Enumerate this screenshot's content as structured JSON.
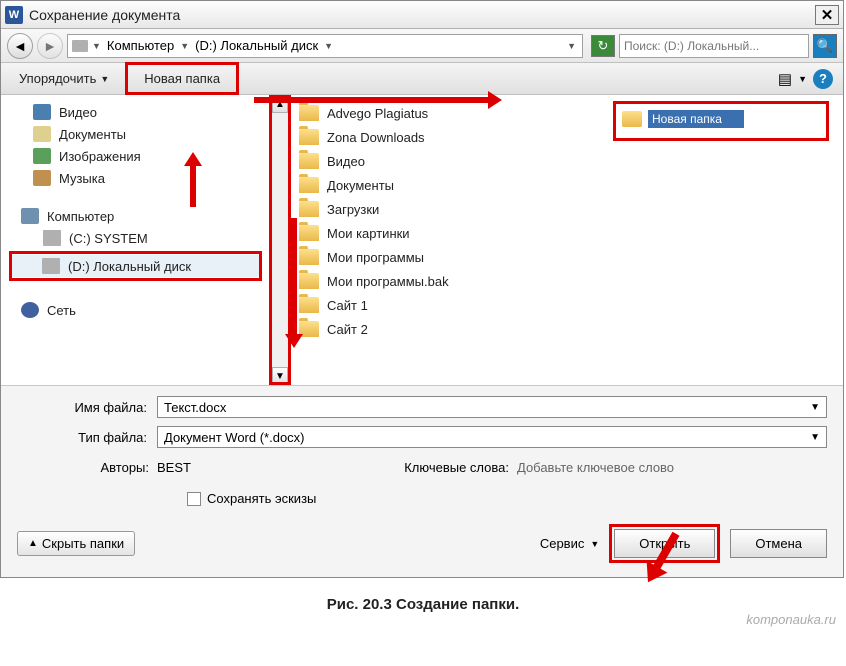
{
  "title": "Сохранение документа",
  "path": {
    "seg1": "Компьютер",
    "seg2": "(D:) Локальный диск"
  },
  "search_placeholder": "Поиск: (D:) Локальный...",
  "toolbar": {
    "organize": "Упорядочить",
    "new_folder": "Новая папка"
  },
  "sidebar": {
    "libs": [
      "Видео",
      "Документы",
      "Изображения",
      "Музыка"
    ],
    "computer": "Компьютер",
    "drives": [
      "(C:) SYSTEM",
      "(D:) Локальный диск"
    ],
    "network": "Сеть"
  },
  "folders": [
    "Advego Plagiatus",
    "Zona Downloads",
    "Видео",
    "Документы",
    "Загрузки",
    "Мои картинки",
    "Мои программы",
    "Мои программы.bak",
    "Сайт 1",
    "Сайт 2"
  ],
  "new_folder_edit": "Новая папка",
  "filename_label": "Имя файла:",
  "filename_value": "Текст.docx",
  "filetype_label": "Тип файла:",
  "filetype_value": "Документ Word (*.docx)",
  "authors_label": "Авторы:",
  "authors_value": "BEST",
  "keywords_label": "Ключевые слова:",
  "keywords_value": "Добавьте ключевое слово",
  "save_thumb": "Сохранять эскизы",
  "hide_folders": "Скрыть папки",
  "service": "Сервис",
  "open": "Открыть",
  "cancel": "Отмена",
  "caption": "Рис. 20.3 Создание папки.",
  "watermark": "komponauka.ru"
}
